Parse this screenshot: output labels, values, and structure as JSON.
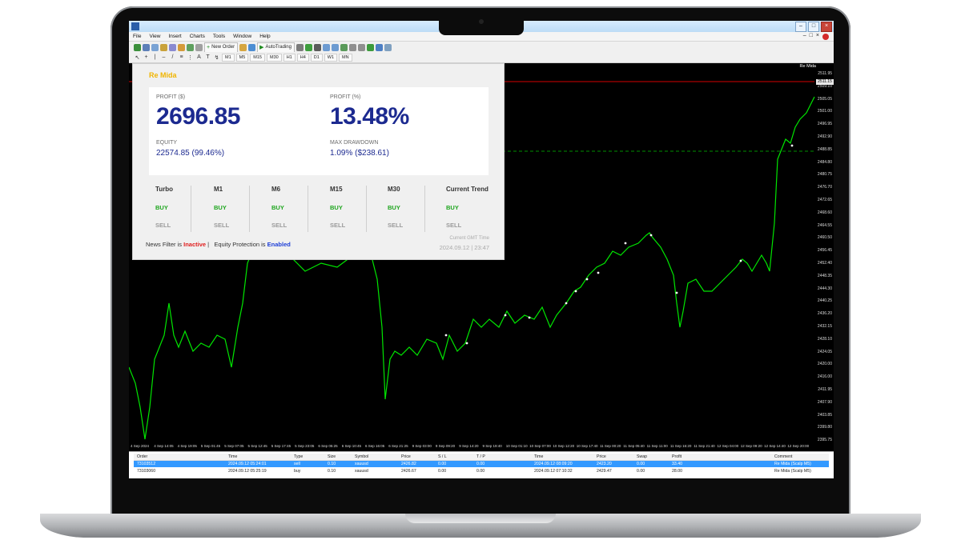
{
  "window": {
    "buttons": [
      "–",
      "□",
      "×"
    ]
  },
  "menu": {
    "items": [
      "File",
      "View",
      "Insert",
      "Charts",
      "Tools",
      "Window",
      "Help"
    ],
    "mdi_buttons": [
      "–",
      "□",
      "×"
    ]
  },
  "toolbar": {
    "new_order_label": "New Order",
    "autotrading_label": "AutoTrading",
    "timeframes": [
      "M1",
      "M5",
      "M15",
      "M30",
      "H1",
      "H4",
      "D1",
      "W1",
      "MN"
    ]
  },
  "chart": {
    "label": "Re Mida",
    "current_price_tag": "2511.15",
    "colors": {
      "background": "#000000",
      "price_line": "#00e600",
      "bid_line": "#d40000",
      "level_line": "#00c000"
    },
    "price_ticks": [
      "2511.95",
      "2509.10",
      "2505.05",
      "2501.00",
      "2496.95",
      "2492.90",
      "2488.85",
      "2484.80",
      "2480.75",
      "2476.70",
      "2472.65",
      "2468.60",
      "2464.55",
      "2460.50",
      "2456.45",
      "2452.40",
      "2448.35",
      "2444.30",
      "2440.25",
      "2436.20",
      "2432.15",
      "2428.10",
      "2424.05",
      "2420.00",
      "2416.00",
      "2411.95",
      "2407.90",
      "2403.85",
      "2399.80",
      "2395.75"
    ],
    "time_ticks": [
      "4 Sep 2024",
      "4 Sep 14:05",
      "4 Sep 19:05",
      "5 Sep 01:45",
      "5 Sep 07:05",
      "5 Sep 12:45",
      "5 Sep 17:45",
      "5 Sep 23:05",
      "6 Sep 05:25",
      "6 Sep 10:45",
      "6 Sep 16:05",
      "6 Sep 21:25",
      "9 Sep 03:00",
      "9 Sep 09:20",
      "9 Sep 14:20",
      "9 Sep 19:40",
      "10 Sep 01:10",
      "10 Sep 07:00",
      "10 Sep 12:20",
      "10 Sep 17:40",
      "11 Sep 00:20",
      "11 Sep 05:40",
      "11 Sep 11:00",
      "11 Sep 16:20",
      "11 Sep 21:40",
      "12 Sep 04:00",
      "12 Sep 09:20",
      "12 Sep 14:40",
      "12 Sep 20:00"
    ]
  },
  "ea_panel": {
    "title": "Re Mida",
    "profit_usd_label": "PROFIT ($)",
    "profit_usd": "2696.85",
    "profit_pct_label": "PROFIT (%)",
    "profit_pct": "13.48%",
    "equity_label": "EQUITY",
    "equity": "22574.85 (99.46%)",
    "drawdown_label": "MAX DRAWDOWN",
    "drawdown": "1.09% ($238.61)",
    "signals": [
      {
        "name": "Turbo",
        "buy": "BUY",
        "sell": "SELL"
      },
      {
        "name": "M1",
        "buy": "BUY",
        "sell": "SELL"
      },
      {
        "name": "M6",
        "buy": "BUY",
        "sell": "SELL"
      },
      {
        "name": "M15",
        "buy": "BUY",
        "sell": "SELL"
      },
      {
        "name": "M30",
        "buy": "BUY",
        "sell": "SELL"
      },
      {
        "name": "Current Trend",
        "buy": "BUY",
        "sell": "SELL"
      }
    ],
    "news_filter_prefix": "News Filter is",
    "news_filter_state": "Inactive",
    "separator": "|",
    "equity_protection_prefix": "Equity Protection is",
    "equity_protection_state": "Enabled",
    "time_label": "Current GMT Time",
    "time_value": "2024.09.12 | 23:47"
  },
  "terminal": {
    "columns": [
      "Order",
      "Time",
      "Type",
      "Size",
      "Symbol",
      "Price",
      "S / L",
      "T / P",
      "Time",
      "Price",
      "Swap",
      "Profit",
      "Comment"
    ],
    "rows": [
      [
        "73103512",
        "2024.09.12 05:24:01",
        "sell",
        "0.10",
        "xauusd",
        "2426.82",
        "0.00",
        "0.00",
        "2024.09.12 08:09:20",
        "2423.20",
        "0.00",
        "33.40",
        "Re Mida (Scalp M5)"
      ],
      [
        "73103060",
        "2024.09.12 05:25:19",
        "buy",
        "0.10",
        "xauusd",
        "2426.67",
        "0.00",
        "0.00",
        "2024.09.12 07:10:32",
        "2429.47",
        "0.00",
        "28.00",
        "Re Mida (Scalp M5)"
      ]
    ]
  }
}
